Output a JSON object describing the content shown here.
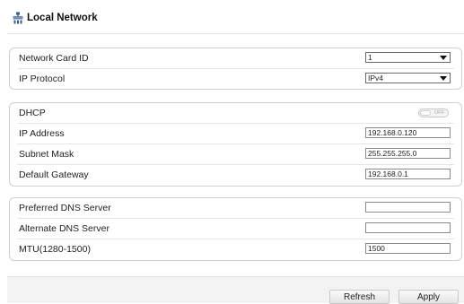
{
  "header": {
    "title": "Local Network",
    "icon": "network-settings-icon"
  },
  "group1": {
    "network_card_id": {
      "label": "Network Card ID",
      "value": "1"
    },
    "ip_protocol": {
      "label": "IP Protocol",
      "value": "IPv4"
    }
  },
  "group2": {
    "dhcp": {
      "label": "DHCP",
      "state": "OFF"
    },
    "ip_address": {
      "label": "IP Address",
      "value": "192.168.0.120"
    },
    "subnet_mask": {
      "label": "Subnet Mask",
      "value": "255.255.255.0"
    },
    "default_gateway": {
      "label": "Default Gateway",
      "value": "192.168.0.1"
    }
  },
  "group3": {
    "preferred_dns": {
      "label": "Preferred DNS Server",
      "value": ""
    },
    "alternate_dns": {
      "label": "Alternate DNS Server",
      "value": ""
    },
    "mtu": {
      "label": "MTU(1280-1500)",
      "value": "1500"
    }
  },
  "footer": {
    "refresh_label": "Refresh",
    "apply_label": "Apply"
  }
}
